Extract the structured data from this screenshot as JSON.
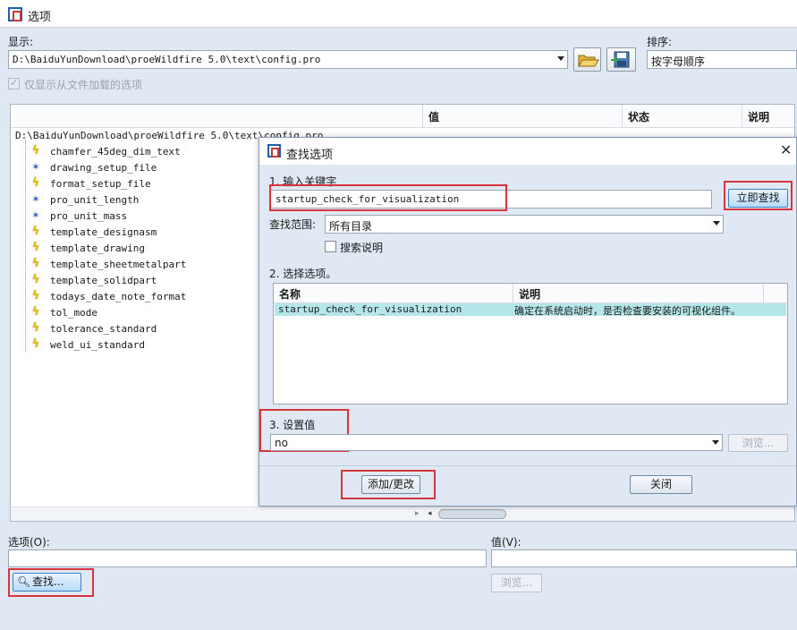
{
  "window": {
    "title": "选项"
  },
  "display": {
    "label": "显示:",
    "path": "D:\\BaiduYunDownload\\proeWildfire 5.0\\text\\config.pro"
  },
  "sort": {
    "label": "排序:",
    "value": "按字母顺序"
  },
  "only_loaded": {
    "label": "仅显示从文件加载的选项",
    "checked": true
  },
  "tree": {
    "columns": [
      "值",
      "状态",
      "说明"
    ],
    "root": "D:\\BaiduYunDownload\\proeWildfire 5.0\\text\\config.pro",
    "items": [
      {
        "name": "chamfer_45deg_dim_text",
        "icon": "yellow-bolt-icon"
      },
      {
        "name": "drawing_setup_file",
        "icon": "blue-star-icon"
      },
      {
        "name": "format_setup_file",
        "icon": "yellow-bolt-icon"
      },
      {
        "name": "pro_unit_length",
        "icon": "blue-star-icon"
      },
      {
        "name": "pro_unit_mass",
        "icon": "blue-star-icon"
      },
      {
        "name": "template_designasm",
        "icon": "yellow-bolt-icon"
      },
      {
        "name": "template_drawing",
        "icon": "yellow-bolt-icon"
      },
      {
        "name": "template_sheetmetalpart",
        "icon": "yellow-bolt-icon"
      },
      {
        "name": "template_solidpart",
        "icon": "yellow-bolt-icon"
      },
      {
        "name": "todays_date_note_format",
        "icon": "yellow-bolt-icon"
      },
      {
        "name": "tol_mode",
        "icon": "yellow-bolt-icon"
      },
      {
        "name": "tolerance_standard",
        "icon": "yellow-bolt-icon"
      },
      {
        "name": "weld_ui_standard",
        "icon": "yellow-bolt-icon"
      }
    ]
  },
  "bottom": {
    "option_label": "选项(O):",
    "value_label": "值(V):",
    "find_button": "查找...",
    "browse_button": "浏览..."
  },
  "dialog": {
    "title": "查找选项",
    "step1": "1.  输入关键字",
    "keyword": "startup_check_for_visualization",
    "search_now": "立即查找",
    "scope_label": "查找范围:",
    "scope_value": "所有目录",
    "search_desc": "搜索说明",
    "step2": "2.  选择选项。",
    "columns": [
      "名称",
      "说明"
    ],
    "result": {
      "name": "startup_check_for_visualization",
      "desc": "确定在系统启动时，是否检查要安装的可视化组件。"
    },
    "step3": "3.  设置值",
    "value": "no",
    "browse": "浏览...",
    "add_change": "添加/更改",
    "close": "关闭"
  },
  "colors": {
    "highlight_red": "#d8343c",
    "selection": "#b5e6ea",
    "accent": "#3d7fc4"
  }
}
